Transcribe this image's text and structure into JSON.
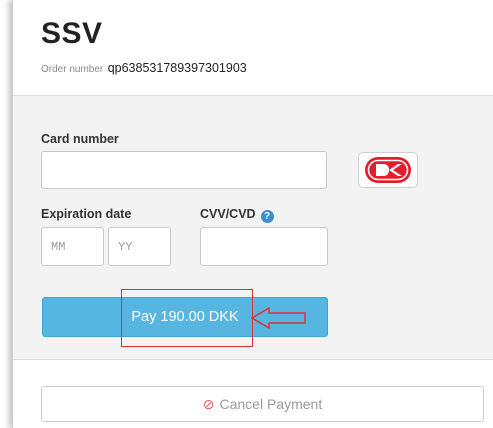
{
  "header": {
    "title": "SSV",
    "order_label": "Order number",
    "order_number": "qp638531789397301903"
  },
  "form": {
    "card_number_label": "Card number",
    "card_number_value": "",
    "expiration_label": "Expiration date",
    "month_placeholder": "MM",
    "year_placeholder": "YY",
    "cvv_label": "CVV/CVD",
    "cvv_value": "",
    "help_icon_glyph": "?",
    "card_brand": "dankort-icon"
  },
  "actions": {
    "pay_label": "Pay 190.00 DKK",
    "cancel_label": "Cancel Payment",
    "cancel_icon_glyph": "⊘"
  },
  "colors": {
    "pay_button": "#57b5e1",
    "annotation": "#e03030",
    "help_icon": "#3b8fd1",
    "cancel_icon": "#e06060"
  }
}
